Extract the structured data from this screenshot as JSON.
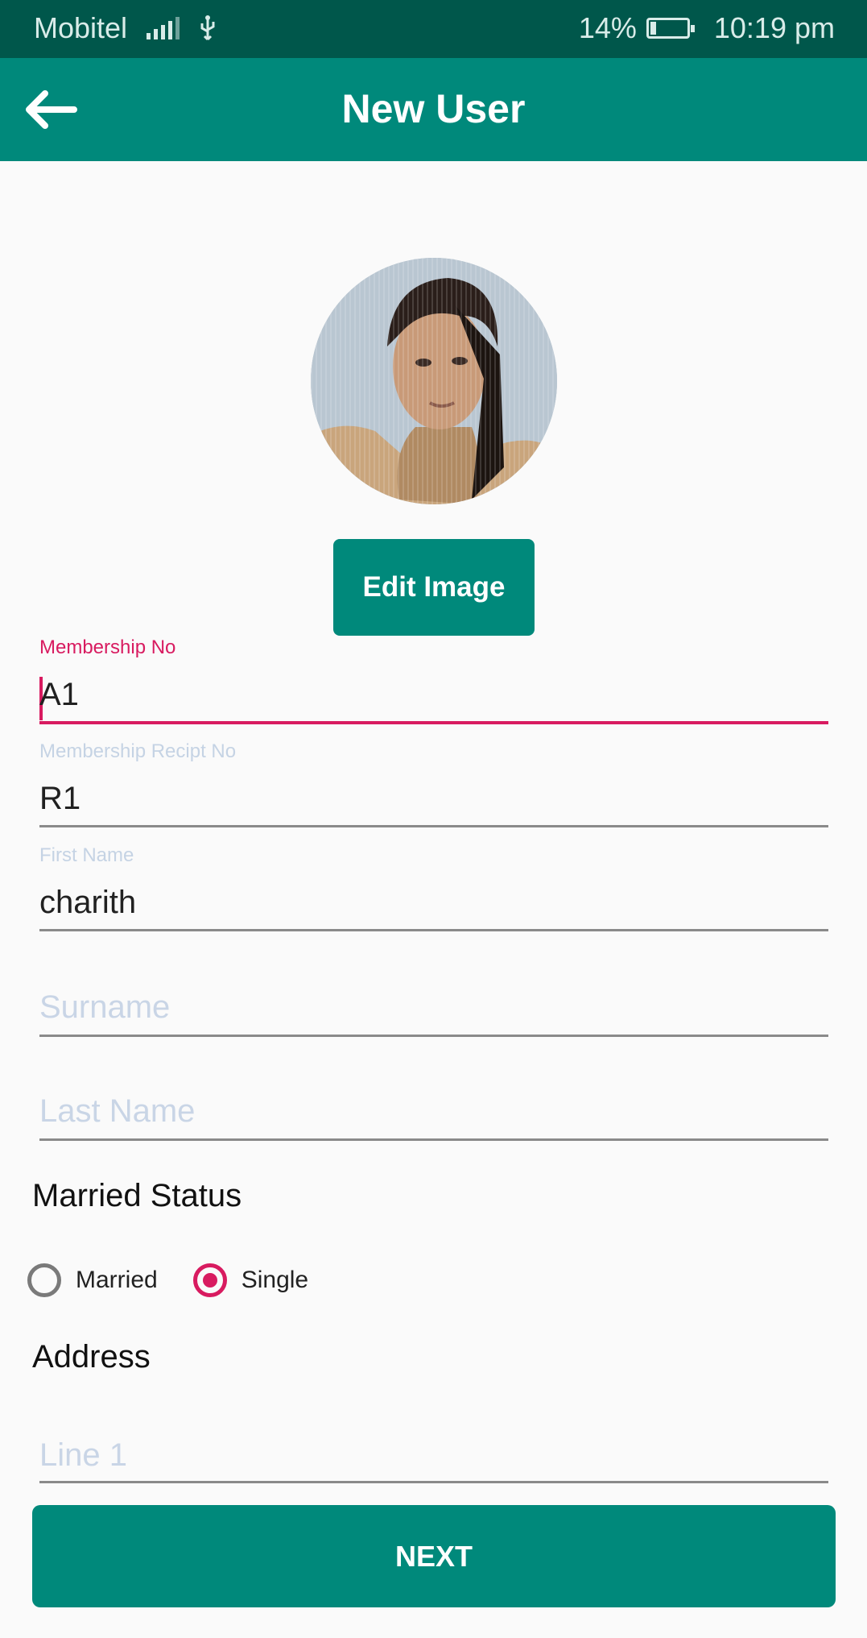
{
  "status_bar": {
    "carrier": "Mobitel",
    "battery_percent": "14%",
    "battery_level": 0.14,
    "time": "10:19 pm",
    "icons": [
      "signal-icon",
      "usb-icon",
      "battery-charging-icon"
    ]
  },
  "app_bar": {
    "title": "New User",
    "back_icon": "arrow-left-icon"
  },
  "profile": {
    "edit_image_label": "Edit Image"
  },
  "form": {
    "membership_no": {
      "label": "Membership No",
      "value": "A1"
    },
    "membership_receipt_no": {
      "label": "Membership Recipt No",
      "value": "R1"
    },
    "first_name": {
      "label": "First Name",
      "value": "charith"
    },
    "surname": {
      "placeholder": "Surname"
    },
    "last_name": {
      "placeholder": "Last Name"
    },
    "married_status": {
      "title": "Married Status",
      "options": [
        {
          "label": "Married",
          "selected": false
        },
        {
          "label": "Single",
          "selected": true
        }
      ]
    },
    "address": {
      "title": "Address",
      "line1": {
        "placeholder": "Line 1"
      }
    }
  },
  "actions": {
    "next_label": "NEXT"
  },
  "colors": {
    "status_bar": "#00574b",
    "app_bar": "#00897b",
    "accent": "#d81b60",
    "hint": "#c9d5e6"
  }
}
